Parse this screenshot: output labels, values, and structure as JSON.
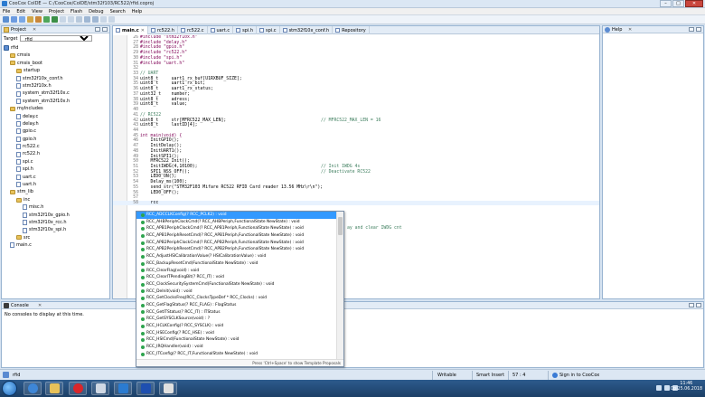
{
  "window": {
    "title": "CooCox CoIDE — C:/CooCox/CoIDE/stm32f103/RC522/rfid.coproj"
  },
  "menu": [
    "File",
    "Edit",
    "View",
    "Project",
    "Flash",
    "Debug",
    "Search",
    "Help"
  ],
  "project_panel": {
    "title": "Project",
    "target_label": "Target",
    "target_value": "rfid",
    "tree": [
      {
        "label": "rfid",
        "type": "project",
        "depth": 0
      },
      {
        "label": "cmsis",
        "type": "folder",
        "depth": 1
      },
      {
        "label": "cmsis_boot",
        "type": "folder",
        "depth": 1
      },
      {
        "label": "startup",
        "type": "folder",
        "depth": 2
      },
      {
        "label": "stm32f10x_conf.h",
        "type": "file",
        "depth": 2
      },
      {
        "label": "stm32f10x.h",
        "type": "file",
        "depth": 2
      },
      {
        "label": "system_stm32f10x.c",
        "type": "file",
        "depth": 2
      },
      {
        "label": "system_stm32f10x.h",
        "type": "file",
        "depth": 2
      },
      {
        "label": "myIncludes",
        "type": "folder",
        "depth": 1
      },
      {
        "label": "delay.c",
        "type": "file",
        "depth": 2
      },
      {
        "label": "delay.h",
        "type": "file",
        "depth": 2
      },
      {
        "label": "gpio.c",
        "type": "file",
        "depth": 2
      },
      {
        "label": "gpio.h",
        "type": "file",
        "depth": 2
      },
      {
        "label": "rc522.c",
        "type": "file",
        "depth": 2
      },
      {
        "label": "rc522.h",
        "type": "file",
        "depth": 2
      },
      {
        "label": "spi.c",
        "type": "file",
        "depth": 2
      },
      {
        "label": "spi.h",
        "type": "file",
        "depth": 2
      },
      {
        "label": "uart.c",
        "type": "file",
        "depth": 2
      },
      {
        "label": "uart.h",
        "type": "file",
        "depth": 2
      },
      {
        "label": "stm_lib",
        "type": "folder",
        "depth": 1
      },
      {
        "label": "inc",
        "type": "folder",
        "depth": 2
      },
      {
        "label": "misc.h",
        "type": "file",
        "depth": 3
      },
      {
        "label": "stm32f10x_gpio.h",
        "type": "file",
        "depth": 3
      },
      {
        "label": "stm32f10x_rcc.h",
        "type": "file",
        "depth": 3
      },
      {
        "label": "stm32f10x_spi.h",
        "type": "file",
        "depth": 3
      },
      {
        "label": "src",
        "type": "folder",
        "depth": 2
      },
      {
        "label": "main.c",
        "type": "file",
        "depth": 1
      }
    ]
  },
  "editor": {
    "tabs": [
      "main.c",
      "rc522.h",
      "rc522.c",
      "uart.c",
      "spi.h",
      "spi.c",
      "stm32f10x_conf.h",
      "Repository"
    ],
    "active_tab": "main.c",
    "lines": [
      {
        "n": "26",
        "t": "#include \"stm32f10x.h\"",
        "c": ""
      },
      {
        "n": "27",
        "t": "#include \"delay.h\"",
        "c": ""
      },
      {
        "n": "28",
        "t": "#include \"gpio.h\"",
        "c": ""
      },
      {
        "n": "29",
        "t": "#include \"rc522.h\"",
        "c": ""
      },
      {
        "n": "30",
        "t": "#include \"spi.h\"",
        "c": ""
      },
      {
        "n": "31",
        "t": "#include \"uart.h\"",
        "c": ""
      },
      {
        "n": "32",
        "t": "",
        "c": ""
      },
      {
        "n": "33",
        "t": "// UART",
        "c": ""
      },
      {
        "n": "34",
        "t": "uint8_t     uart1_rx_buf[U1RXBUF_SIZE];",
        "c": ""
      },
      {
        "n": "35",
        "t": "uint8_t     uart1_rx_bit;",
        "c": ""
      },
      {
        "n": "36",
        "t": "uint8_t     uart1_rx_status;",
        "c": ""
      },
      {
        "n": "37",
        "t": "uint32_t    number;",
        "c": ""
      },
      {
        "n": "38",
        "t": "uint8_t     adress;",
        "c": ""
      },
      {
        "n": "39",
        "t": "uint8_t     value;",
        "c": ""
      },
      {
        "n": "40",
        "t": "",
        "c": ""
      },
      {
        "n": "41",
        "t": "// RC522",
        "c": ""
      },
      {
        "n": "42",
        "t": "uint8_t     str[MFRC522_MAX_LEN];",
        "c": "// MFRC522_MAX_LEN = 16"
      },
      {
        "n": "43",
        "t": "uint8_t     lastID[4];",
        "c": ""
      },
      {
        "n": "44",
        "t": "",
        "c": ""
      },
      {
        "n": "45",
        "t": "int main(void) {",
        "c": ""
      },
      {
        "n": "46",
        "t": "    InitGPIO();",
        "c": ""
      },
      {
        "n": "47",
        "t": "    InitDelay();",
        "c": ""
      },
      {
        "n": "48",
        "t": "    InitUART1();",
        "c": ""
      },
      {
        "n": "49",
        "t": "    InitSPI1();",
        "c": ""
      },
      {
        "n": "50",
        "t": "    MFRC522_Init();",
        "c": ""
      },
      {
        "n": "51",
        "t": "    InitIWDG(4,10100);",
        "c": "// Init IWDG 4s"
      },
      {
        "n": "52",
        "t": "    SPI1_NSS_OFF();",
        "c": "// Deactivate RC522"
      },
      {
        "n": "53",
        "t": "    LED0_ON();",
        "c": ""
      },
      {
        "n": "54",
        "t": "    Delay_ms(100);",
        "c": ""
      },
      {
        "n": "55",
        "t": "    send_str(\"STM32F103 Mifare RC522 RFID Card reader 13.56 MHz\\r\\n\");",
        "c": ""
      },
      {
        "n": "56",
        "t": "    LED0_OFF();",
        "c": ""
      },
      {
        "n": "57",
        "t": "",
        "c": ""
      },
      {
        "n": "58",
        "t": "    rcc",
        "c": ""
      }
    ],
    "hint": "ay and clear IWDG cnt"
  },
  "autocomplete": {
    "items": [
      "RCC_ADCCLKConfig(? RCC_PCLK2) : void",
      "RCC_AHBPeriphClockCmd(? RCC_AHBPeriph,FunctionalState NewState) : void",
      "RCC_APB1PeriphClockCmd(? RCC_APB1Periph,FunctionalState NewState) : void",
      "RCC_APB1PeriphResetCmd(? RCC_APB1Periph,FunctionalState NewState) : void",
      "RCC_APB2PeriphClockCmd(? RCC_APB2Periph,FunctionalState NewState) : void",
      "RCC_APB2PeriphResetCmd(? RCC_APB2Periph,FunctionalState NewState) : void",
      "RCC_AdjustHSICalibrationValue(? HSICalibrationValue) : void",
      "RCC_BackupResetCmd(FunctionalState NewState) : void",
      "RCC_ClearFlag(void) : void",
      "RCC_ClearITPendingBit(? RCC_IT) : void",
      "RCC_ClockSecuritySystemCmd(FunctionalState NewState) : void",
      "RCC_DeInit(void) : void",
      "RCC_GetClocksFreq(RCC_ClocksTypeDef * RCC_Clocks) : void",
      "RCC_GetFlagStatus(? RCC_FLAG) : FlagStatus",
      "RCC_GetITStatus(? RCC_IT) : ITStatus",
      "RCC_GetSYSCLKSource(void) : ?",
      "RCC_HCLKConfig(? RCC_SYSCLK) : void",
      "RCC_HSEConfig(? RCC_HSE) : void",
      "RCC_HSICmd(FunctionalState NewState) : void",
      "RCC_IRQHandler(void) : void",
      "RCC_ITConfig(? RCC_IT,FunctionalState NewState) : void"
    ],
    "footer": "Press 'Ctrl+Space' to show Template Proposals"
  },
  "help_panel": {
    "title": "Help"
  },
  "console_panel": {
    "title": "Console",
    "message": "No consoles to display at this time."
  },
  "statusbar": {
    "project": "rfid",
    "mode": "Writable",
    "insert": "Smart Insert",
    "position": "57 : 4",
    "signin": "Sign in to CooCox"
  },
  "taskbar": {
    "time": "11:46",
    "date": "Ср 25.06.2018"
  },
  "colors": {
    "accent": "#3399ff",
    "keyword": "#7f0055",
    "string": "#2a00ff",
    "comment": "#3f7f5f"
  }
}
